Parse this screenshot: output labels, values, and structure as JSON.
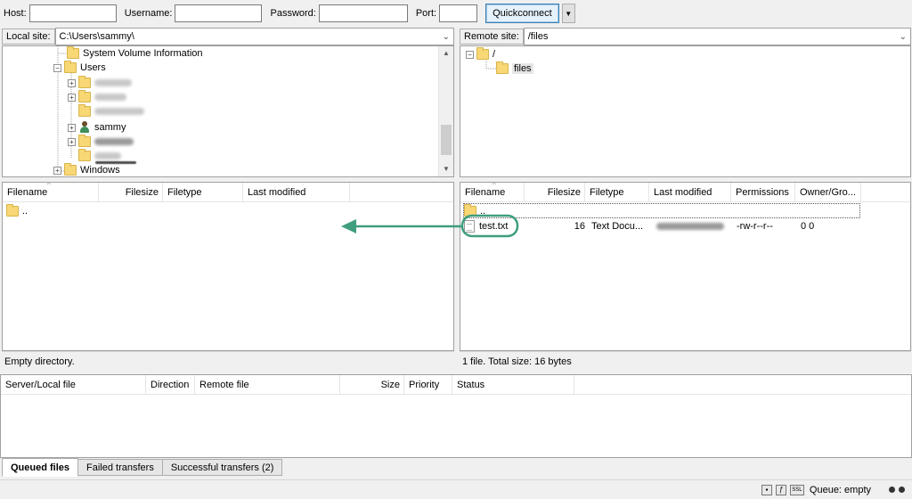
{
  "quickconnect": {
    "host_label": "Host:",
    "username_label": "Username:",
    "password_label": "Password:",
    "port_label": "Port:",
    "host_value": "",
    "username_value": "",
    "password_value": "",
    "port_value": "",
    "button_label": "Quickconnect",
    "dropdown_icon": "triangle-down-icon"
  },
  "local": {
    "site_label": "Local site:",
    "path": "C:\\Users\\sammy\\",
    "tree": [
      {
        "label": "System Volume Information",
        "blurred": false
      },
      {
        "label": "Users",
        "blurred": false
      },
      {
        "label": "",
        "blurred": true
      },
      {
        "label": "",
        "blurred": true
      },
      {
        "label": "",
        "blurred": true
      },
      {
        "label": "sammy",
        "blurred": false
      },
      {
        "label": "",
        "blurred": true
      },
      {
        "label": "",
        "blurred": true
      },
      {
        "label": "Windows",
        "blurred": false
      }
    ],
    "columns": [
      "Filename",
      "Filesize",
      "Filetype",
      "Last modified"
    ],
    "files": [
      {
        "name": ".."
      }
    ],
    "status": "Empty directory."
  },
  "remote": {
    "site_label": "Remote site:",
    "path": "/files",
    "tree": [
      {
        "label": "/"
      },
      {
        "label": "files"
      }
    ],
    "columns": [
      "Filename",
      "Filesize",
      "Filetype",
      "Last modified",
      "Permissions",
      "Owner/Gro..."
    ],
    "files": [
      {
        "name": "..",
        "size": "",
        "type": "",
        "modified": "",
        "perms": "",
        "owner": ""
      },
      {
        "name": "test.txt",
        "size": "16",
        "type": "Text Docu...",
        "modified": "",
        "perms": "-rw-r--r--",
        "owner": "0 0"
      }
    ],
    "status": "1 file. Total size: 16 bytes"
  },
  "queue": {
    "columns": [
      "Server/Local file",
      "Direction",
      "Remote file",
      "Size",
      "Priority",
      "Status"
    ],
    "tabs": [
      "Queued files",
      "Failed transfers",
      "Successful transfers (2)"
    ]
  },
  "statusbar": {
    "queue_text": "Queue: empty"
  },
  "colors": {
    "highlight_green": "#3e9e7d",
    "folder": "#f8d775"
  }
}
